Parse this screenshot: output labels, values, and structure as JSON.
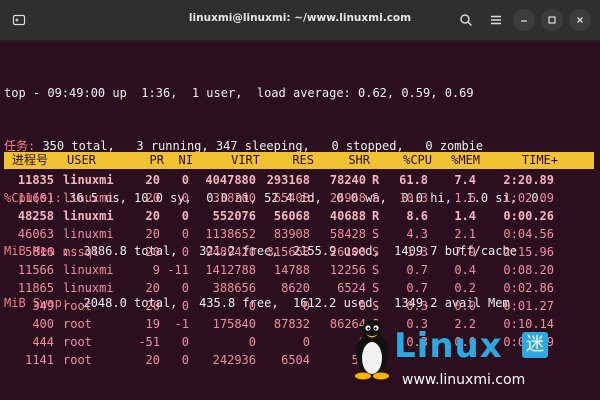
{
  "window": {
    "title": "linuxmi@linuxmi: ~/www.linuxmi.com",
    "icons": [
      "new-tab-icon",
      "search-icon",
      "hamburger-menu-icon",
      "minimize-icon",
      "maximize-icon",
      "close-icon"
    ]
  },
  "top_lines": {
    "line1": "top - 09:49:00 up  1:36,  1 user,  load average: 0.62, 0.59, 0.69",
    "tasks_label": "任务:",
    "tasks_rest": " 350 total,   3 running, 347 sleeping,   0 stopped,   0 zombie",
    "cpu_label": "%Cpu(s):",
    "cpu_rest": " 36.5 us, 10.0 sy,  0.0 ni, 52.4 id,  0.0 wa,  0.0 hi,  1.0 si,  0.",
    "mem_label": "MiB Mem :",
    "mem_rest": "  3886.8 total,   321.2 free,  2155.9 used,  1409.7 buff/cache",
    "swap_label": "MiB Swap:",
    "swap_rest": "  2048.0 total,   435.8 free,  1612.2 used.  1349.2 avail Mem"
  },
  "table": {
    "headers": {
      "pid": "进程号",
      "user": "USER",
      "pr": "PR",
      "ni": "NI",
      "virt": "VIRT",
      "res": "RES",
      "shr": "SHR",
      "s": "",
      "cpu": "%CPU",
      "mem": "%MEM",
      "time": "TIME+"
    },
    "rows": [
      {
        "pid": "11835",
        "user": "linuxmi",
        "pr": "20",
        "ni": "0",
        "virt": "4047880",
        "res": "293168",
        "shr": "78240",
        "s": "R",
        "cpu": "61.8",
        "mem": "7.4",
        "time": "2:20.89",
        "bold": true
      },
      {
        "pid": "11601",
        "user": "linuxmi",
        "pr": "20",
        "ni": "0",
        "virt": "338200",
        "res": "65408",
        "shr": "26968",
        "s": "S",
        "cpu": "10.3",
        "mem": "1.6",
        "time": "1:02.09",
        "bold": false
      },
      {
        "pid": "48258",
        "user": "linuxmi",
        "pr": "20",
        "ni": "0",
        "virt": "552076",
        "res": "56068",
        "shr": "40688",
        "s": "R",
        "cpu": "8.6",
        "mem": "1.4",
        "time": "0:00.26",
        "bold": true
      },
      {
        "pid": "46063",
        "user": "linuxmi",
        "pr": "20",
        "ni": "0",
        "virt": "1138652",
        "res": "83908",
        "shr": "58428",
        "s": "S",
        "cpu": "4.3",
        "mem": "2.1",
        "time": "0:04.56",
        "bold": false
      },
      {
        "pid": "5816",
        "user": "mssql",
        "pr": "20",
        "ni": "0",
        "virt": "9489420",
        "res": "315668",
        "shr": "26100",
        "s": "S",
        "cpu": "1.3",
        "mem": "7.9",
        "time": "2:15.96",
        "bold": false
      },
      {
        "pid": "11566",
        "user": "linuxmi",
        "pr": "9",
        "ni": "-11",
        "virt": "1412788",
        "res": "14788",
        "shr": "12256",
        "s": "S",
        "cpu": "0.7",
        "mem": "0.4",
        "time": "0:08.20",
        "bold": false
      },
      {
        "pid": "11865",
        "user": "linuxmi",
        "pr": "20",
        "ni": "0",
        "virt": "388656",
        "res": "8620",
        "shr": "6524",
        "s": "S",
        "cpu": "0.7",
        "mem": "0.2",
        "time": "0:02.86",
        "bold": false
      },
      {
        "pid": "349",
        "user": "root",
        "pr": "20",
        "ni": "0",
        "virt": "0",
        "res": "0",
        "shr": "0",
        "s": "S",
        "cpu": "0.3",
        "mem": "0.0",
        "time": "0:01.27",
        "bold": false
      },
      {
        "pid": "400",
        "user": "root",
        "pr": "19",
        "ni": "-1",
        "virt": "175840",
        "res": "87832",
        "shr": "86264",
        "s": "S",
        "cpu": "0.3",
        "mem": "2.2",
        "time": "0:10.14",
        "bold": false
      },
      {
        "pid": "444",
        "user": "root",
        "pr": "-51",
        "ni": "0",
        "virt": "0",
        "res": "0",
        "shr": "0",
        "s": "S",
        "cpu": "0.3",
        "mem": "0.0",
        "time": "0:00.69",
        "bold": false
      },
      {
        "pid": "1141",
        "user": "root",
        "pr": "20",
        "ni": "0",
        "virt": "242936",
        "res": "6504",
        "shr": "54",
        "s": "",
        "cpu": "",
        "mem": "",
        "time": "",
        "bold": false
      }
    ]
  },
  "watermark": {
    "brand": "Linux",
    "brand_char": "迷",
    "url": "www.linuxmi.com"
  }
}
